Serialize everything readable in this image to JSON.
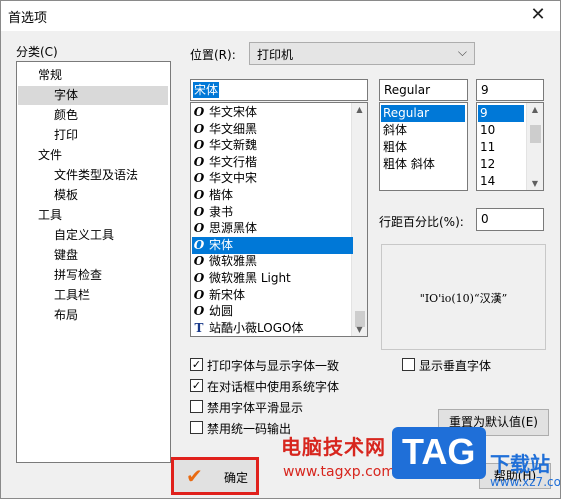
{
  "window": {
    "title": "首选项",
    "close_glyph": "✕"
  },
  "category": {
    "label": "分类(C)",
    "items": [
      {
        "label": "常规",
        "level": 1
      },
      {
        "label": "字体",
        "level": 2,
        "selected": true
      },
      {
        "label": "颜色",
        "level": 2
      },
      {
        "label": "打印",
        "level": 2
      },
      {
        "label": "文件",
        "level": 1
      },
      {
        "label": "文件类型及语法",
        "level": 2
      },
      {
        "label": "模板",
        "level": 2
      },
      {
        "label": "工具",
        "level": 1
      },
      {
        "label": "自定义工具",
        "level": 2
      },
      {
        "label": "键盘",
        "level": 2
      },
      {
        "label": "拼写检查",
        "level": 2
      },
      {
        "label": "工具栏",
        "level": 2
      },
      {
        "label": "布局",
        "level": 2
      }
    ]
  },
  "position": {
    "label": "位置(R):",
    "value": "打印机"
  },
  "font": {
    "input_value": "宋体",
    "items": [
      {
        "label": "华文宋体",
        "icon": "opentype-icon"
      },
      {
        "label": "华文细黑",
        "icon": "opentype-icon"
      },
      {
        "label": "华文新魏",
        "icon": "opentype-icon"
      },
      {
        "label": "华文行楷",
        "icon": "opentype-icon"
      },
      {
        "label": "华文中宋",
        "icon": "opentype-icon"
      },
      {
        "label": "楷体",
        "icon": "opentype-icon"
      },
      {
        "label": "隶书",
        "icon": "opentype-icon"
      },
      {
        "label": "思源黑体",
        "icon": "opentype-icon"
      },
      {
        "label": "宋体",
        "icon": "opentype-icon",
        "selected": true
      },
      {
        "label": "微软雅黑",
        "icon": "opentype-icon"
      },
      {
        "label": "微软雅黑 Light",
        "icon": "opentype-icon"
      },
      {
        "label": "新宋体",
        "icon": "opentype-icon"
      },
      {
        "label": "幼圆",
        "icon": "opentype-icon"
      },
      {
        "label": "站酷小薇LOGO体",
        "icon": "truetype-icon"
      }
    ]
  },
  "style": {
    "input_value": "Regular",
    "items": [
      "Regular",
      "斜体",
      "粗体",
      "粗体 斜体"
    ],
    "selected_index": 0
  },
  "size": {
    "input_value": "9",
    "items": [
      "9",
      "10",
      "11",
      "12",
      "14"
    ],
    "selected_index": 0
  },
  "line_spacing": {
    "label": "行距百分比(%):",
    "value": "0"
  },
  "preview": {
    "text": "\"IO'io(10)“汉漢”"
  },
  "options": [
    {
      "label": "打印字体与显示字体一致",
      "checked": true
    },
    {
      "label": "在对话框中使用系统字体",
      "checked": true
    },
    {
      "label": "禁用字体平滑显示",
      "checked": false
    },
    {
      "label": "禁用统一码输出",
      "checked": false
    }
  ],
  "show_vertical_font": {
    "label": "显示垂直字体",
    "checked": false
  },
  "buttons": {
    "reset": "重置为默认值(E)",
    "ok": "确定",
    "help": "帮助(H)",
    "check_glyph": "✔"
  },
  "watermark": {
    "site_name": "电脑技术网",
    "site_url": "www.tagxp.com",
    "logo_text": "TAG",
    "download_text": "下载站",
    "download_url": "www.xz7.com"
  },
  "colors": {
    "selection": "#0078d7",
    "highlight_box": "#e0201b",
    "logo_blue": "#1f6fd8",
    "watermark_red": "#d7261e"
  }
}
